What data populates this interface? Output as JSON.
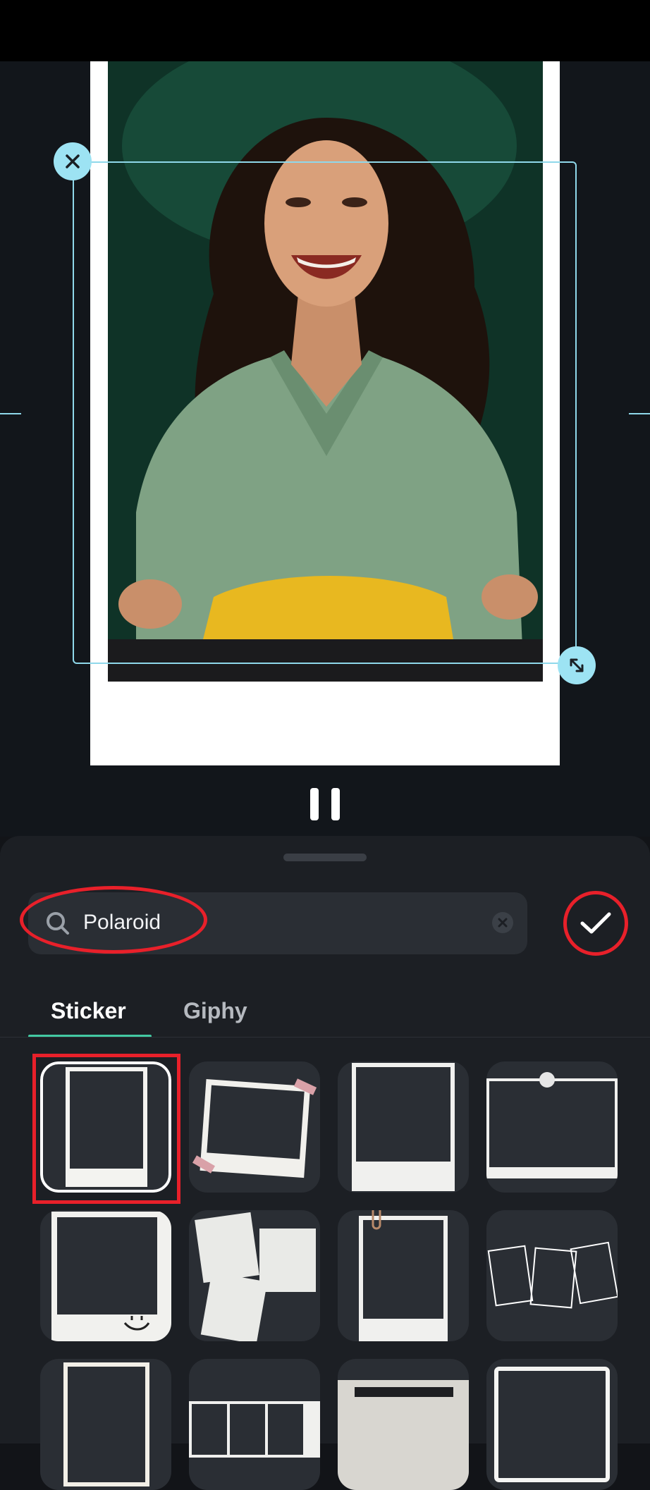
{
  "editor": {
    "photo_subject": "photo of smiling woman in green shirt inside polaroid frame"
  },
  "search": {
    "query": "Polaroid",
    "placeholder": "Search"
  },
  "tabs": [
    {
      "label": "Sticker"
    },
    {
      "label": "Giphy"
    }
  ],
  "stickers": [
    {
      "name": "polaroid-plain"
    },
    {
      "name": "polaroid-taped"
    },
    {
      "name": "polaroid-square"
    },
    {
      "name": "polaroid-pinned"
    },
    {
      "name": "polaroid-smiley"
    },
    {
      "name": "polaroid-stack"
    },
    {
      "name": "polaroid-clip"
    },
    {
      "name": "polaroid-trio"
    },
    {
      "name": "polaroid-rough-border"
    },
    {
      "name": "polaroid-film-strip"
    },
    {
      "name": "polaroid-torn-film"
    },
    {
      "name": "polaroid-marker-frame"
    }
  ],
  "colors": {
    "accent": "#43c9a2",
    "selection": "#8fd8ea",
    "annotation": "#e8202a"
  }
}
